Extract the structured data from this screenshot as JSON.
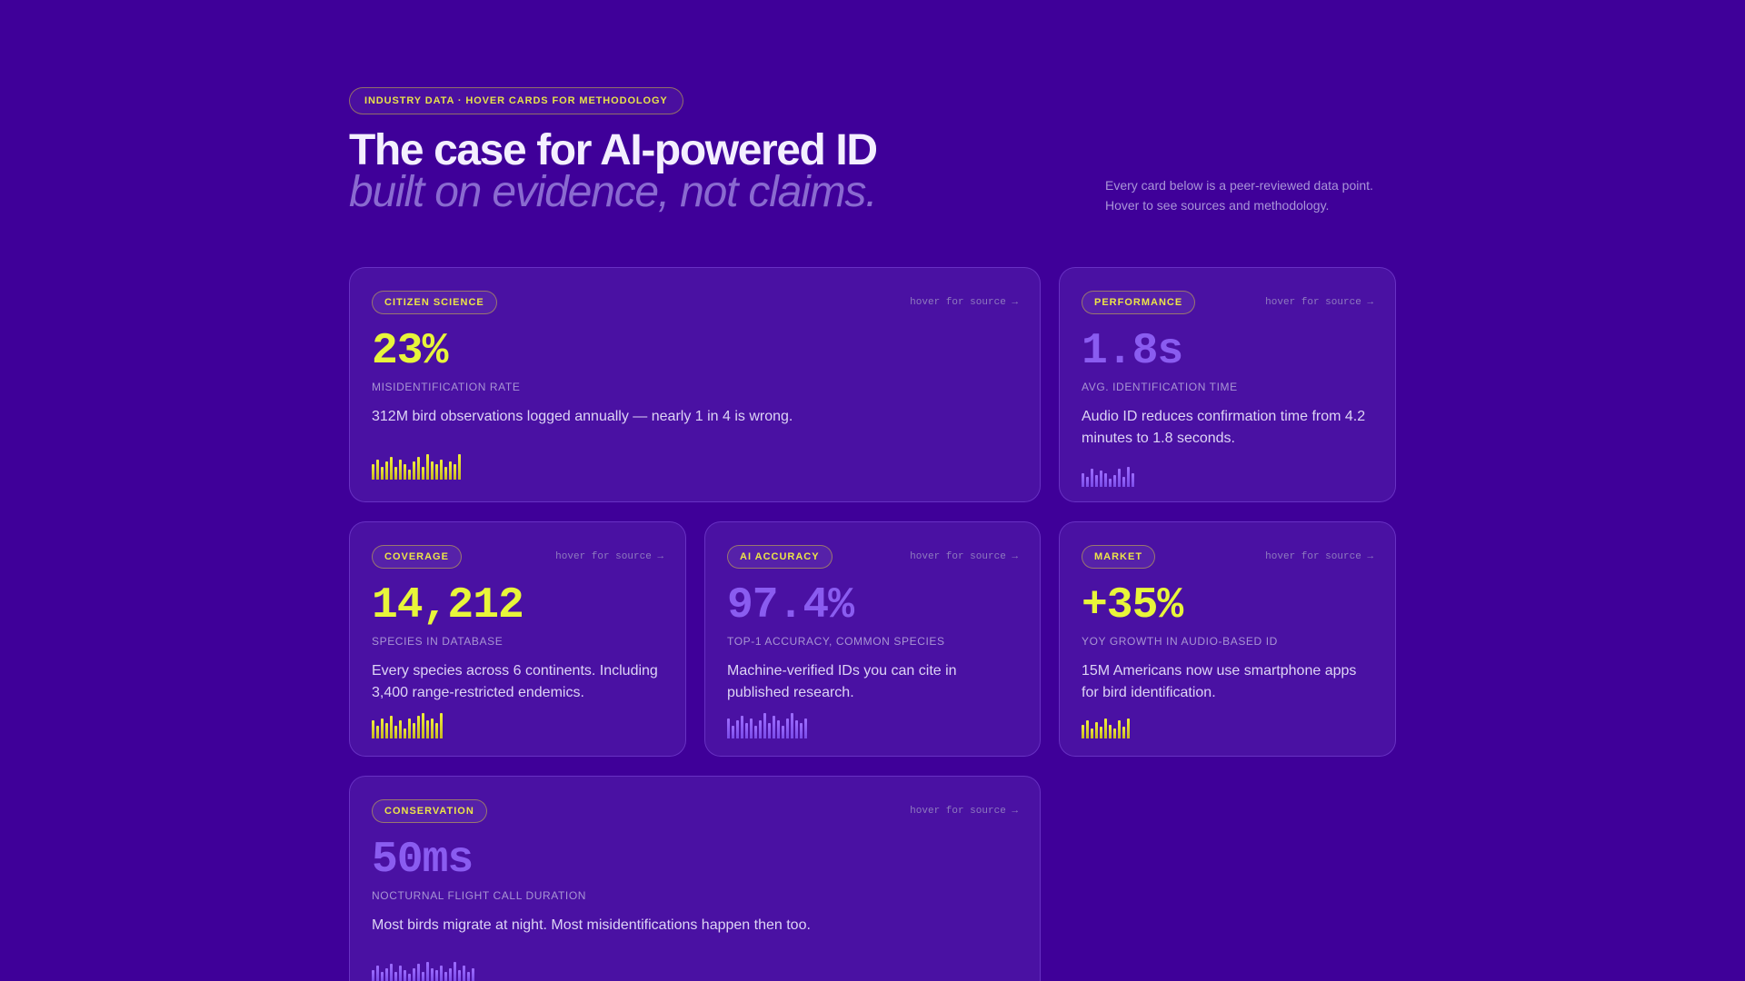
{
  "header": {
    "eyebrow": "INDUSTRY DATA · HOVER CARDS FOR METHODOLOGY",
    "title": "The case for AI-powered ID",
    "subtitle": "built on evidence, not claims.",
    "intro": "Every card below is a peer-reviewed data point. Hover to see sources and methodology."
  },
  "colors": {
    "background": "#3f0099",
    "card": "#4a11a3",
    "accent_yellow": "#e8f53a",
    "accent_violet": "#8a5cf0"
  },
  "cards": [
    {
      "tag": "CITIZEN SCIENCE",
      "hint": "hover for source →",
      "value": "23%",
      "label": "MISIDENTIFICATION RATE",
      "description": "312M bird observations logged annually — nearly 1 in 4 is wrong.",
      "accent": "yellow",
      "bars": [
        0.6,
        0.8,
        0.5,
        0.7,
        0.9,
        0.5,
        0.8,
        0.6,
        0.4,
        0.7,
        0.9,
        0.5,
        1.0,
        0.7,
        0.6,
        0.8,
        0.5,
        0.7,
        0.6,
        1.0
      ]
    },
    {
      "tag": "PERFORMANCE",
      "hint": "hover for source →",
      "value": "1.8s",
      "label": "AVG. IDENTIFICATION TIME",
      "description": "Audio ID reduces confirmation time from 4.2 minutes to 1.8 seconds.",
      "accent": "violet",
      "bars": [
        0.7,
        0.5,
        0.9,
        0.6,
        0.8,
        0.7,
        0.4,
        0.6,
        0.9,
        0.5,
        1.0,
        0.7
      ]
    },
    {
      "tag": "COVERAGE",
      "hint": "hover for source →",
      "value": "14,212",
      "label": "SPECIES IN DATABASE",
      "description": "Every species across 6 continents. Including 3,400 range-restricted endemics.",
      "accent": "yellow",
      "bars": [
        0.7,
        0.5,
        0.8,
        0.6,
        0.9,
        0.5,
        0.7,
        0.4,
        0.8,
        0.6,
        0.9,
        1.0,
        0.7,
        0.8,
        0.6,
        1.0
      ]
    },
    {
      "tag": "AI ACCURACY",
      "hint": "hover for source →",
      "value": "97.4%",
      "label": "TOP-1 ACCURACY, COMMON SPECIES",
      "description": "Machine-verified IDs you can cite in published research.",
      "accent": "violet",
      "bars": [
        0.8,
        0.5,
        0.7,
        0.9,
        0.6,
        0.8,
        0.5,
        0.7,
        1.0,
        0.6,
        0.9,
        0.7,
        0.5,
        0.8,
        1.0,
        0.7,
        0.6,
        0.8
      ]
    },
    {
      "tag": "MARKET",
      "hint": "hover for source →",
      "value": "+35%",
      "label": "YOY GROWTH IN AUDIO-BASED ID",
      "description": "15M Americans now use smartphone apps for bird identification.",
      "accent": "yellow",
      "bars": [
        0.7,
        0.9,
        0.5,
        0.8,
        0.6,
        1.0,
        0.7,
        0.5,
        0.9,
        0.6,
        1.0
      ]
    },
    {
      "tag": "CONSERVATION",
      "hint": "hover for source →",
      "value": "50ms",
      "label": "NOCTURNAL FLIGHT CALL DURATION",
      "description": "Most birds migrate at night. Most misidentifications happen then too.",
      "accent": "violet",
      "bars": [
        0.6,
        0.8,
        0.5,
        0.7,
        0.9,
        0.5,
        0.8,
        0.6,
        0.4,
        0.7,
        0.9,
        0.5,
        1.0,
        0.7,
        0.6,
        0.8,
        0.5,
        0.7,
        1.0,
        0.6,
        0.8,
        0.5,
        0.7
      ]
    }
  ]
}
